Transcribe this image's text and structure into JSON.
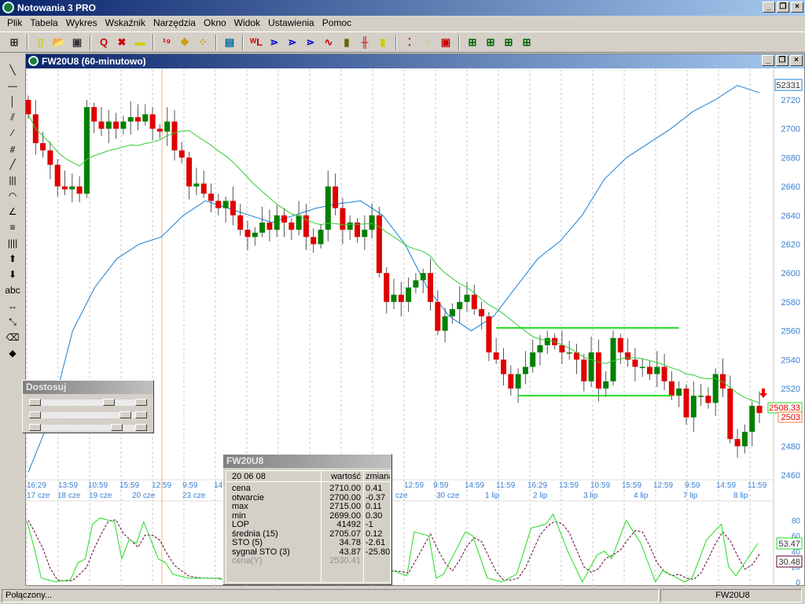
{
  "app": {
    "title": "Notowania 3 PRO",
    "window_buttons": [
      "_",
      "❐",
      "×"
    ]
  },
  "menu": [
    "Plik",
    "Tabela",
    "Wykres",
    "Wskaźnik",
    "Narzędzia",
    "Okno",
    "Widok",
    "Ustawienia",
    "Pomoc"
  ],
  "toolbar_icons": [
    "grid-icon",
    "new-file-icon",
    "open-folder-icon",
    "save-icon",
    "zoom-icon",
    "zoom-off-icon",
    "ruler-icon",
    "numbers-icon",
    "cursor-icon",
    "crosshair-icon",
    "table-icon",
    "wl-icon",
    "arrow1-icon",
    "arrow2-icon",
    "arrow3-icon",
    "line-chart-icon",
    "bar-chart-icon",
    "ohlc-icon",
    "candle-icon",
    "traffic-light-icon",
    "add-marker-icon",
    "add-window-icon",
    "layout1-icon",
    "layout2-icon",
    "layout3-icon",
    "layout4-icon"
  ],
  "left_tools": [
    {
      "n": "diagonal-line-tool",
      "g": "╲"
    },
    {
      "n": "horizontal-line-tool",
      "g": "—"
    },
    {
      "n": "vertical-line-tool",
      "g": "│"
    },
    {
      "n": "parallel-lines-tool",
      "g": "⫽"
    },
    {
      "n": "fan-tool",
      "g": "⁄"
    },
    {
      "n": "gann-tool",
      "g": "⧣"
    },
    {
      "n": "trend-line-tool",
      "g": "╱"
    },
    {
      "n": "cycles-tool",
      "g": "|||"
    },
    {
      "n": "arcs-tool",
      "g": "◠"
    },
    {
      "n": "speed-lines-tool",
      "g": "∠"
    },
    {
      "n": "fibo-tool",
      "g": "≡"
    },
    {
      "n": "time-zones-tool",
      "g": "||||"
    },
    {
      "n": "up-arrow-tool",
      "g": "⬆"
    },
    {
      "n": "down-arrow-tool",
      "g": "⬇"
    },
    {
      "n": "text-tool",
      "g": "abc"
    },
    {
      "n": "move-tool",
      "g": "↔"
    },
    {
      "n": "resize-tool",
      "g": "⤡"
    },
    {
      "n": "eraser-tool",
      "g": "⌫"
    },
    {
      "n": "erase-all-tool",
      "g": "◆"
    }
  ],
  "chart_window": {
    "title": "FW20U8 (60-minutowo)"
  },
  "chart_data": {
    "type": "candlestick",
    "price_axis": {
      "ticks": [
        2720,
        2700,
        2680,
        2660,
        2640,
        2620,
        2600,
        2580,
        2560,
        2540,
        2520,
        2500,
        2480,
        2460
      ],
      "range": [
        2460,
        2720
      ]
    },
    "closes": [
      2710,
      2690,
      2685,
      2675,
      2660,
      2658,
      2660,
      2655,
      2715,
      2705,
      2700,
      2705,
      2700,
      2705,
      2708,
      2705,
      2710,
      2700,
      2698,
      2705,
      2685,
      2680,
      2660,
      2662,
      2655,
      2650,
      2645,
      2650,
      2640,
      2630,
      2625,
      2628,
      2635,
      2630,
      2640,
      2635,
      2630,
      2640,
      2625,
      2620,
      2630,
      2660,
      2645,
      2630,
      2635,
      2625,
      2630,
      2640,
      2600,
      2580,
      2585,
      2580,
      2590,
      2595,
      2600,
      2580,
      2560,
      2570,
      2575,
      2580,
      2585,
      2575,
      2570,
      2545,
      2540,
      2530,
      2520,
      2530,
      2535,
      2545,
      2550,
      2555,
      2550,
      2545,
      2545,
      2540,
      2525,
      2545,
      2520,
      2525,
      2555,
      2545,
      2540,
      2535,
      2535,
      2530,
      2535,
      2525,
      2515,
      2520,
      2500,
      2515,
      2515,
      2510,
      2530,
      2520,
      2485,
      2480,
      2490,
      2508,
      2503
    ],
    "first_open": 2720,
    "ma_period": 15,
    "secondary_series": {
      "label": "52331",
      "values": [
        2462,
        2500,
        2560,
        2590,
        2610,
        2620,
        2625,
        2640,
        2650,
        2645,
        2640,
        2635,
        2640,
        2645,
        2648,
        2650,
        2640,
        2620,
        2590,
        2570,
        2560,
        2570,
        2590,
        2610,
        2622,
        2640,
        2665,
        2680,
        2690,
        2700,
        2712,
        2720,
        2730,
        2725
      ]
    },
    "horizontal_lines": [
      {
        "price": 2562,
        "from": 64,
        "to": 89
      },
      {
        "price": 2515,
        "from": 67,
        "to": 88
      }
    ],
    "last_labels": {
      "ma": "2508.33",
      "price": "2503"
    },
    "time_labels": [
      "16:29",
      "13:59",
      "10:59",
      "15:59",
      "12:59",
      "9:59",
      "14",
      "12:59",
      "9:59",
      "14:59",
      "11:59",
      "16:29",
      "13:59",
      "10:59",
      "15:59",
      "12:59",
      "9:59",
      "14:59",
      "11:59"
    ],
    "date_labels": [
      "17 cze",
      "18 cze",
      "19 cze",
      "20 cze",
      "23 cze",
      "cze",
      "30 cze",
      "1 lip",
      "2 lip",
      "3 lip",
      "4 lip",
      "7 lip",
      "8 lip"
    ],
    "oscillator": {
      "ticks": [
        80,
        60,
        40,
        20,
        0
      ],
      "range": [
        0,
        100
      ],
      "sto_last": "53.47",
      "signal_last": "30.48",
      "sto_points": [
        [
          0,
          80
        ],
        [
          1,
          45
        ],
        [
          2,
          5
        ],
        [
          4,
          0
        ],
        [
          6,
          3
        ],
        [
          7,
          25
        ],
        [
          8,
          30
        ],
        [
          9,
          75
        ],
        [
          10,
          83
        ],
        [
          12,
          78
        ],
        [
          13,
          30
        ],
        [
          14,
          55
        ],
        [
          15,
          50
        ],
        [
          16,
          78
        ],
        [
          18,
          30
        ],
        [
          19,
          25
        ],
        [
          20,
          10
        ],
        [
          22,
          5
        ],
        [
          26,
          5
        ],
        [
          28,
          0
        ],
        [
          50,
          15
        ],
        [
          52,
          8
        ],
        [
          53,
          65
        ],
        [
          55,
          60
        ],
        [
          56,
          5
        ],
        [
          57,
          10
        ],
        [
          60,
          65
        ],
        [
          61,
          60
        ],
        [
          63,
          5
        ],
        [
          65,
          0
        ],
        [
          67,
          10
        ],
        [
          69,
          70
        ],
        [
          71,
          75
        ],
        [
          72,
          88
        ],
        [
          74,
          40
        ],
        [
          76,
          0
        ],
        [
          78,
          35
        ],
        [
          79,
          40
        ],
        [
          80,
          30
        ],
        [
          82,
          80
        ],
        [
          84,
          50
        ],
        [
          86,
          0
        ],
        [
          87,
          15
        ],
        [
          90,
          0
        ],
        [
          91,
          5
        ],
        [
          93,
          55
        ],
        [
          95,
          75
        ],
        [
          96,
          20
        ],
        [
          97,
          8
        ],
        [
          100,
          50
        ]
      ]
    }
  },
  "colors": {
    "up": "#008000",
    "down": "#e00000",
    "ma": "#33cc33",
    "secondary": "#1a7fd4",
    "axis_text": "#3a7fd0"
  },
  "popup": {
    "title": "FW20U8",
    "date": "20 06 08",
    "col_value": "wartość",
    "col_change": "zmiana",
    "rows": [
      [
        "cena",
        "2710.00",
        "0.41"
      ],
      [
        "otwarcie",
        "2700.00",
        "-0.37"
      ],
      [
        "max",
        "2715.00",
        "0.11"
      ],
      [
        "min",
        "2699.00",
        "0.30"
      ],
      [
        "LOP",
        "41492",
        "-1"
      ],
      [
        "średnia (15)",
        "2705.07",
        "0.12"
      ],
      [
        "STO (5)",
        "34.78",
        "-2.61"
      ],
      [
        "sygnał STO (3)",
        "43.87",
        "-25.80"
      ],
      [
        "cena(Y)",
        "2530.41",
        ""
      ]
    ]
  },
  "adjust_panel": {
    "title": "Dostosuj",
    "levels": [
      0.75,
      0.95,
      0.85
    ]
  },
  "status": {
    "left": "Połączony...",
    "right": "FW20U8"
  }
}
